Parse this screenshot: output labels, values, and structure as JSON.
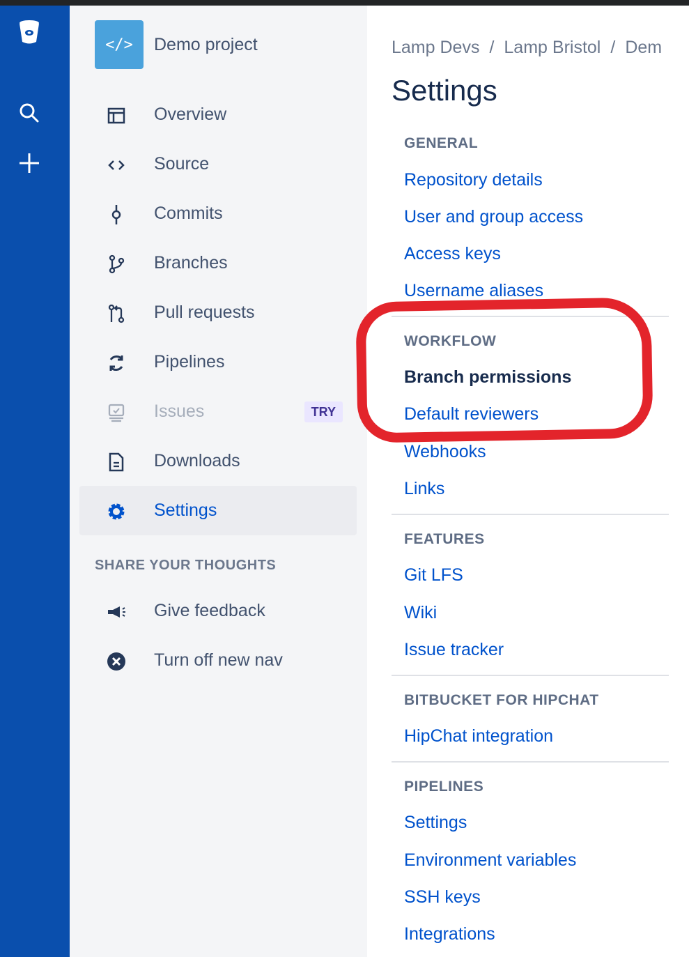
{
  "colors": {
    "global_nav": "#0a4fad",
    "sidebar_bg": "#f4f5f7",
    "link": "#0052cc",
    "text": "#42526e",
    "annotation": "#e3242b"
  },
  "global_nav": {
    "items": [
      {
        "icon": "bitbucket-logo-icon"
      },
      {
        "icon": "search-icon"
      },
      {
        "icon": "create-plus-icon"
      }
    ]
  },
  "project": {
    "avatar_icon": "code-brackets-icon",
    "avatar_text": "</>",
    "name": "Demo project"
  },
  "sidebar": {
    "items": [
      {
        "label": "Overview",
        "icon": "overview-icon"
      },
      {
        "label": "Source",
        "icon": "source-code-icon"
      },
      {
        "label": "Commits",
        "icon": "commit-icon"
      },
      {
        "label": "Branches",
        "icon": "branches-icon"
      },
      {
        "label": "Pull requests",
        "icon": "pull-request-icon"
      },
      {
        "label": "Pipelines",
        "icon": "pipelines-icon"
      },
      {
        "label": "Issues",
        "icon": "issues-icon",
        "badge": "TRY",
        "disabled": true
      },
      {
        "label": "Downloads",
        "icon": "downloads-icon"
      },
      {
        "label": "Settings",
        "icon": "gear-icon",
        "active": true
      }
    ],
    "share_heading": "SHARE YOUR THOUGHTS",
    "share_items": [
      {
        "label": "Give feedback",
        "icon": "megaphone-icon"
      },
      {
        "label": "Turn off new nav",
        "icon": "close-circle-icon"
      }
    ]
  },
  "breadcrumb": {
    "items": [
      "Lamp Devs",
      "Lamp Bristol",
      "Dem"
    ],
    "separator": "/"
  },
  "page_title": "Settings",
  "settings": {
    "general": {
      "heading": "GENERAL",
      "links": [
        "Repository details",
        "User and group access",
        "Access keys",
        "Username aliases"
      ]
    },
    "workflow": {
      "heading": "WORKFLOW",
      "links": [
        "Branch permissions",
        "Default reviewers",
        "Webhooks",
        "Links"
      ],
      "current": "Branch permissions"
    },
    "features": {
      "heading": "FEATURES",
      "links": [
        "Git LFS",
        "Wiki",
        "Issue tracker"
      ]
    },
    "hipchat": {
      "heading": "BITBUCKET FOR HIPCHAT",
      "links": [
        "HipChat integration"
      ]
    },
    "pipelines": {
      "heading": "PIPELINES",
      "links": [
        "Settings",
        "Environment variables",
        "SSH keys",
        "Integrations"
      ]
    }
  }
}
